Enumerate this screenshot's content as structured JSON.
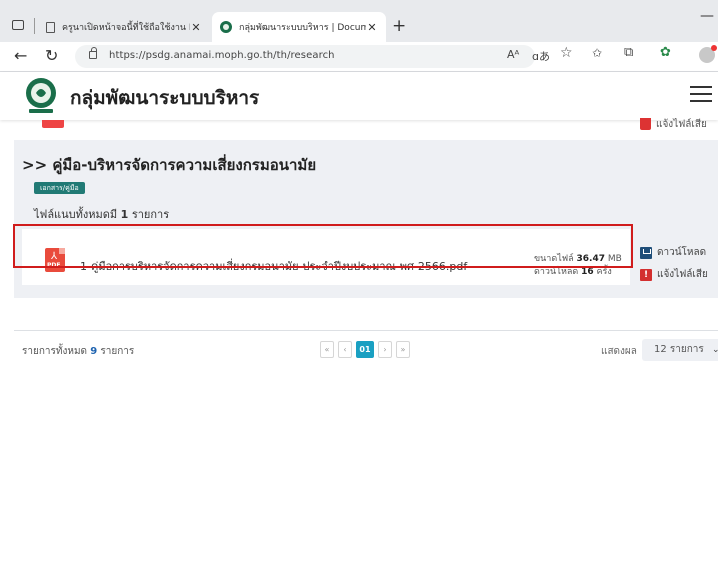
{
  "browser": {
    "tabs": [
      {
        "title": "ครูนาเปิดหน้าจอนี้ที่ใช้ถือใช้งาน Inte",
        "active": false
      },
      {
        "title": "กลุ่มพัฒนาระบบบริหาร | Document",
        "active": true
      }
    ],
    "new_tab_symbol": "+",
    "minimize_symbol": "—",
    "url": "https://psdg.anamai.moph.go.th/th/research",
    "toolbar_icons": [
      "read-aloud-icon",
      "translate-icon",
      "favorite-icon",
      "favorites-list-icon",
      "collections-icon",
      "extensions-icon",
      "profile-avatar"
    ]
  },
  "site": {
    "title": "กลุ่มพัฒนาระบบบริหาร"
  },
  "above_section": {
    "report_label": "แจ้งไฟล์เสีย"
  },
  "category": {
    "title": ">> คู่มือ-บริหารจัดการความเสี่ยงกรมอนามัย",
    "tag": "เอกสาร/คู่มือ",
    "file_count_prefix": "ไฟล์แนบทั้งหมดมี",
    "file_count": "1",
    "file_count_suffix": "รายการ"
  },
  "files": [
    {
      "name": "1-คู่มือการบริหารจัดการความเสี่ยงกรมอนามัย-ประจำปีงบประมาณ-พศ-2566.pdf",
      "size_label": "ขนาดไฟล์",
      "size_value": "36.47",
      "size_unit": "MB",
      "downloads_label": "ดาวน์โหลด",
      "downloads_value": "16",
      "downloads_unit": "ครั้ง",
      "file_type": "PDF",
      "download_label": "ดาวน์โหลด",
      "report_label": "แจ้งไฟล์เสีย"
    }
  ],
  "footer": {
    "total_prefix": "รายการทั้งหมด",
    "total_count": "9",
    "total_suffix": "รายการ",
    "pagination": {
      "first": "«",
      "prev": "‹",
      "current": "01",
      "next": "›",
      "last": "»"
    },
    "page_size_label": "แสดงผล",
    "page_size_value": "12 รายการ"
  },
  "colors": {
    "highlight_border": "#d01c1c",
    "tag_bg": "#217a75",
    "pagination_active": "#1aa0c2",
    "count_link": "#1e63b0",
    "pdf_red": "#e94b3c"
  }
}
